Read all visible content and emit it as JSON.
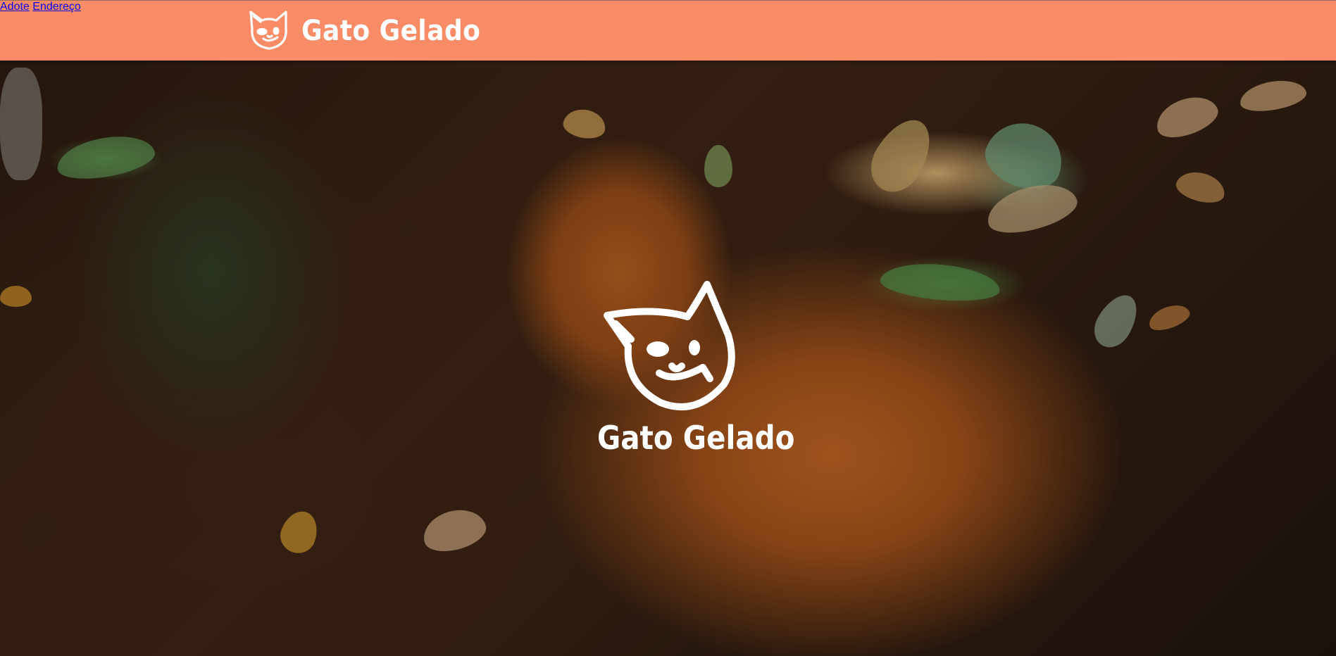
{
  "header": {
    "brand_name": "Gato Gelado",
    "logo_icon": "cat-face-icon",
    "background_color": "#f98b67",
    "nav": [
      {
        "label": "Adote"
      },
      {
        "label": "Endereço"
      }
    ]
  },
  "hero": {
    "logo_icon": "cat-face-icon",
    "title": "Gato Gelado",
    "background_image": "orange cat on autumn leaves photo"
  }
}
